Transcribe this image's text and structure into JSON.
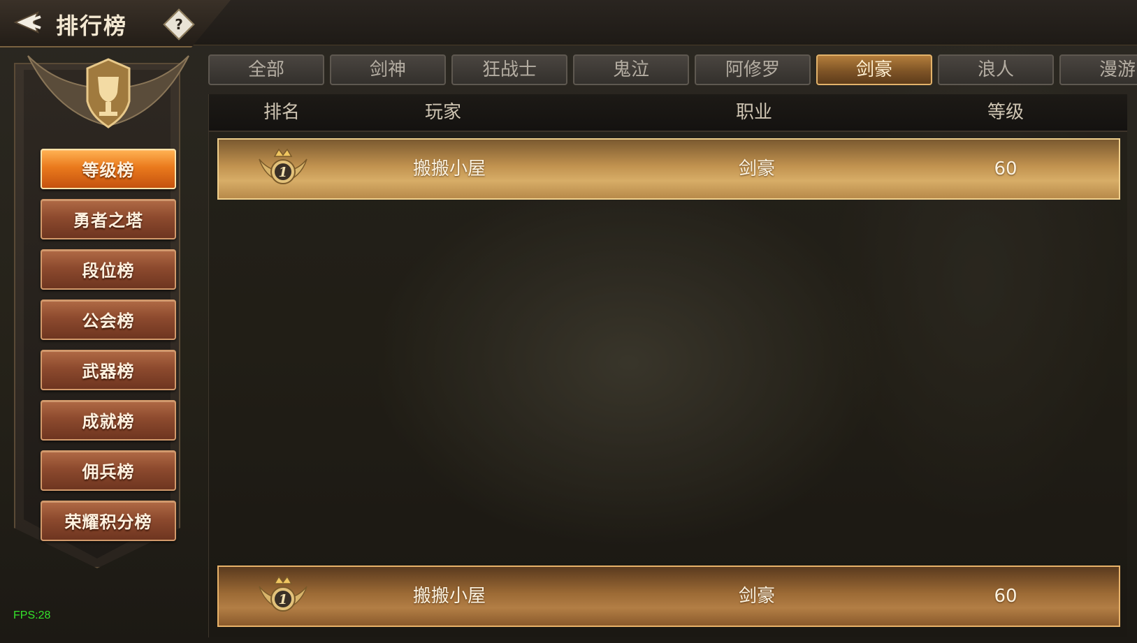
{
  "header": {
    "title": "排行榜",
    "help_label": "?"
  },
  "sidebar": {
    "items": [
      {
        "label": "等级榜",
        "active": true
      },
      {
        "label": "勇者之塔"
      },
      {
        "label": "段位榜"
      },
      {
        "label": "公会榜"
      },
      {
        "label": "武器榜"
      },
      {
        "label": "成就榜"
      },
      {
        "label": "佣兵榜"
      },
      {
        "label": "荣耀积分榜"
      }
    ]
  },
  "tabs": [
    {
      "label": "全部"
    },
    {
      "label": "剑神"
    },
    {
      "label": "狂战士"
    },
    {
      "label": "鬼泣"
    },
    {
      "label": "阿修罗"
    },
    {
      "label": "剑豪",
      "active": true
    },
    {
      "label": "浪人"
    },
    {
      "label": "漫游"
    }
  ],
  "table": {
    "columns": [
      "排名",
      "玩家",
      "职业",
      "等级"
    ],
    "rows": [
      {
        "rank": "1",
        "player": "搬搬小屋",
        "class": "剑豪",
        "level": "60"
      }
    ],
    "my_row": {
      "rank": "1",
      "player": "搬搬小屋",
      "class": "剑豪",
      "level": "60"
    }
  },
  "fps": "FPS:28",
  "colors": {
    "active_orange": "#ea7a1d",
    "gold_row": "#c1924f",
    "fps_green": "#35e32b"
  }
}
